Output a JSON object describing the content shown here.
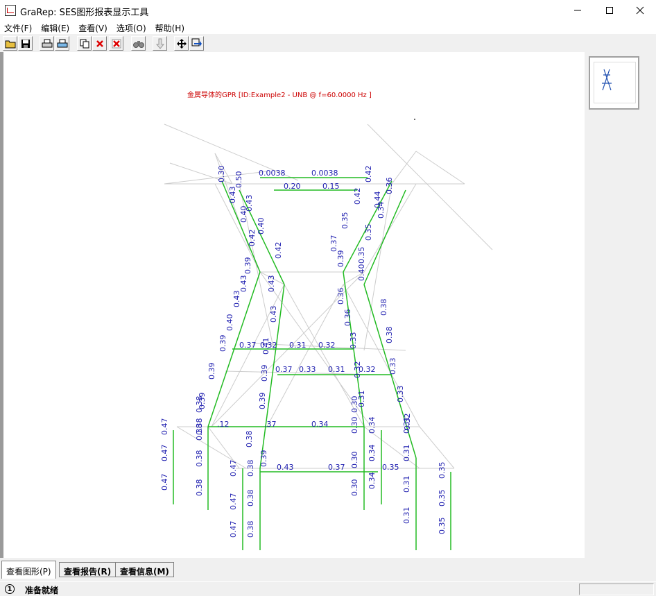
{
  "window": {
    "title": "GraRep: SES图形报表显示工具",
    "minimize_icon": "minimize-icon",
    "maximize_icon": "maximize-icon",
    "close_icon": "close-icon"
  },
  "menu": [
    "文件(F)",
    "编辑(E)",
    "查看(V)",
    "选项(O)",
    "帮助(H)"
  ],
  "toolbar": {
    "buttons": [
      "open-folder-icon",
      "save-icon",
      "print-icon",
      "print-preview-icon",
      "copy-icon",
      "delete-icon",
      "delete-all-icon",
      "find-icon",
      "down-arrow-icon",
      "move-icon",
      "fit-icon"
    ]
  },
  "plot": {
    "title": "金属导体的GPR [ID:Example2 - UNB  @ f=60.0000 Hz ]",
    "title_color": "#cc0000",
    "label_color": "#2020b0",
    "conductor_color": "#22bb22",
    "structure_color": "#c8c8c8",
    "labels_horizontal": [
      "0.0038",
      "0.0038",
      "0.20",
      "0.15",
      "0.37",
      "0.32",
      "0.31",
      "0.32",
      "0.37",
      "0.33",
      "0.31",
      "0.32",
      ".12",
      ".37",
      "0.34",
      "0.43",
      "0.37",
      "0.35"
    ],
    "labels_vertical": [
      "0.30",
      "0.50",
      "0.43",
      "0.43",
      "0.40",
      "0.40",
      "0.42",
      "0.42",
      "0.42",
      "0.36",
      "0.42",
      "0.44",
      "0.34",
      "0.35",
      "0.35",
      "0.37",
      "0.35",
      "0.39",
      "0.39",
      "0.43",
      "0.43",
      "0.43",
      "0.43",
      "0.40",
      "0.40",
      "0.38",
      "0.38",
      "0.36",
      "0.36",
      "0.39",
      "0.41",
      "0.33",
      "0.39",
      "0.39",
      "0.32",
      "0.33",
      "0.39",
      "0.39",
      "0.31",
      "0.33",
      "0.32",
      "0.47",
      "0.47",
      "0.47",
      "0.38",
      "0.38",
      "0.38",
      "0.38",
      "0.39",
      "0.47",
      "0.47",
      "0.47",
      "0.38",
      "0.38",
      "0.38",
      "0.30",
      "0.30",
      "0.30",
      "0.34",
      "0.34",
      "0.34",
      "0.31",
      "0.31",
      "0.31",
      "0.35",
      "0.35",
      "0.35",
      "0.38",
      "0.38",
      "0.30",
      "0.31"
    ]
  },
  "tabs": [
    "查看图形(P)",
    "查看报告(R)",
    "查看信息(M)"
  ],
  "status": {
    "icon_label": "1",
    "text": "准备就绪"
  }
}
